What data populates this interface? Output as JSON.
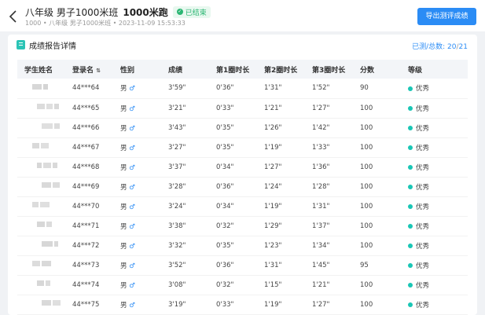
{
  "header": {
    "title_prefix": "八年级 男子1000米班",
    "title_event": "1000米跑",
    "status_label": "已结束",
    "subtitle": "1000 • 八年级 男子1000米班 • 2023-11-09 15:53:33",
    "export_label": "导出测评成绩"
  },
  "card": {
    "title": "成绩报告详情",
    "count_label": "已测/总数:",
    "tested": "20",
    "total": "21"
  },
  "columns": [
    "学生姓名",
    "登录名",
    "性别",
    "成绩",
    "第1圈时长",
    "第2圈时长",
    "第3圈时长",
    "分数",
    "等级"
  ],
  "rows": [
    {
      "login": "44***64",
      "gender": "男",
      "score": "3'59\"",
      "lap1": "0'36\"",
      "lap2": "1'31\"",
      "lap3": "1'52\"",
      "points": "90",
      "level": "优秀"
    },
    {
      "login": "44***65",
      "gender": "男",
      "score": "3'21\"",
      "lap1": "0'33\"",
      "lap2": "1'21\"",
      "lap3": "1'27\"",
      "points": "100",
      "level": "优秀"
    },
    {
      "login": "44***66",
      "gender": "男",
      "score": "3'43\"",
      "lap1": "0'35\"",
      "lap2": "1'26\"",
      "lap3": "1'42\"",
      "points": "100",
      "level": "优秀"
    },
    {
      "login": "44***67",
      "gender": "男",
      "score": "3'27\"",
      "lap1": "0'35\"",
      "lap2": "1'19\"",
      "lap3": "1'33\"",
      "points": "100",
      "level": "优秀"
    },
    {
      "login": "44***68",
      "gender": "男",
      "score": "3'37\"",
      "lap1": "0'34\"",
      "lap2": "1'27\"",
      "lap3": "1'36\"",
      "points": "100",
      "level": "优秀"
    },
    {
      "login": "44***69",
      "gender": "男",
      "score": "3'28\"",
      "lap1": "0'36\"",
      "lap2": "1'24\"",
      "lap3": "1'28\"",
      "points": "100",
      "level": "优秀"
    },
    {
      "login": "44***70",
      "gender": "男",
      "score": "3'24\"",
      "lap1": "0'34\"",
      "lap2": "1'19\"",
      "lap3": "1'31\"",
      "points": "100",
      "level": "优秀"
    },
    {
      "login": "44***71",
      "gender": "男",
      "score": "3'38\"",
      "lap1": "0'32\"",
      "lap2": "1'29\"",
      "lap3": "1'37\"",
      "points": "100",
      "level": "优秀"
    },
    {
      "login": "44***72",
      "gender": "男",
      "score": "3'32\"",
      "lap1": "0'35\"",
      "lap2": "1'23\"",
      "lap3": "1'34\"",
      "points": "100",
      "level": "优秀"
    },
    {
      "login": "44***73",
      "gender": "男",
      "score": "3'52\"",
      "lap1": "0'36\"",
      "lap2": "1'31\"",
      "lap3": "1'45\"",
      "points": "95",
      "level": "优秀"
    },
    {
      "login": "44***74",
      "gender": "男",
      "score": "3'08\"",
      "lap1": "0'32\"",
      "lap2": "1'15\"",
      "lap3": "1'21\"",
      "points": "100",
      "level": "优秀"
    },
    {
      "login": "44***75",
      "gender": "男",
      "score": "3'19\"",
      "lap1": "0'33\"",
      "lap2": "1'19\"",
      "lap3": "1'27\"",
      "points": "100",
      "level": "优秀"
    }
  ],
  "icons": {
    "back": "back-arrow-icon",
    "status": "check-circle-icon",
    "report": "report-icon",
    "sort": "sort-icon",
    "male": "male-symbol-icon",
    "level": "level-dot-icon"
  },
  "colors": {
    "accent": "#2b8cf5",
    "status": "#2bb673",
    "level": "#19c6b5"
  }
}
